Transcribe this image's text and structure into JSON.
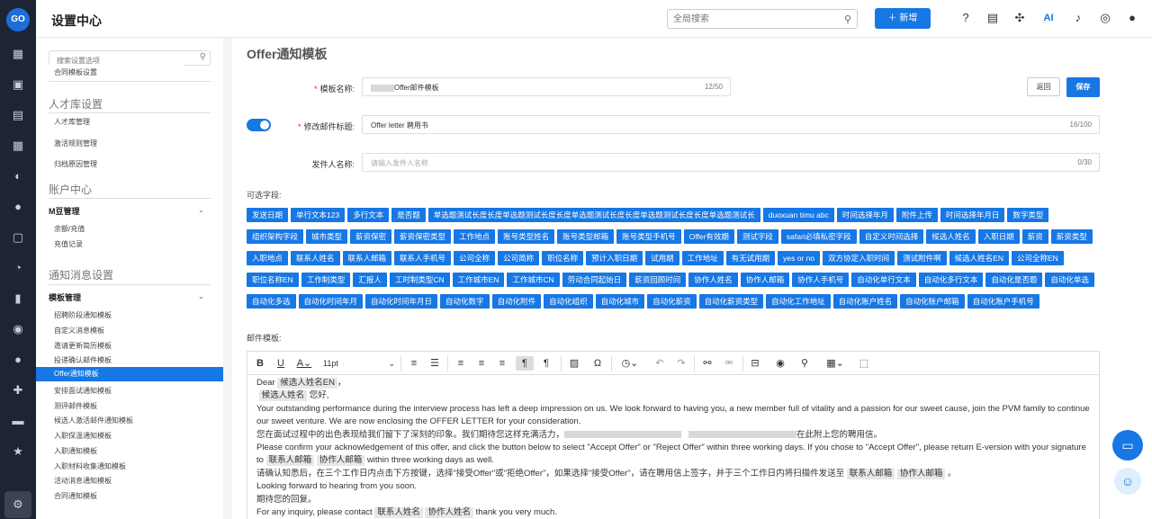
{
  "app": {
    "title": "设置中心",
    "logo_text": "GO"
  },
  "header": {
    "search_placeholder": "全局搜索",
    "new_button": "＋ 新增"
  },
  "sidebar": {
    "search_placeholder": "搜索设置选项",
    "top_item": "合同模板设置",
    "sec_talent": "人才库设置",
    "talent_items": [
      "人才库管理",
      "激活规则管理",
      "归档原因管理"
    ],
    "sec_account": "账户中心",
    "grp_m": "M豆管理",
    "m_items": [
      "余额/充值",
      "充值记录"
    ],
    "sec_notify": "通知消息设置",
    "grp_tpl": "模板管理",
    "tpl_items": [
      "招聘阶段通知模板",
      "自定义消息模板",
      "邀请更新简历模板",
      "投递确认邮件模板",
      "Offer通知模板",
      "安排面试通知模板",
      "测评邮件模板",
      "候选人激活邮件通知模板",
      "入职保温通知模板",
      "入职通知模板",
      "入职材料收集通知模板",
      "活动消息通知模板",
      "合同通知模板"
    ]
  },
  "form": {
    "page_title": "Offer通知模板",
    "name_label": "模板名称:",
    "name_value": "Offer邮件模板",
    "name_count": "12/50",
    "back_button": "返回",
    "save_button": "保存",
    "subject_label": "修改邮件标题:",
    "subject_value": "Offer letter 聘用书",
    "subject_count": "16/100",
    "sender_label": "发件人名称:",
    "sender_placeholder": "请输入发件人名称",
    "sender_count": "0/30",
    "fields_label": "可选字段:",
    "template_label": "邮件模板:"
  },
  "fields": [
    "发送日期",
    "单行文本123",
    "多行文本",
    "是否题",
    "单选题测试长度长度单选题测试长度长度单选题测试长度长度单选题测试长度长度单选题测试长",
    "duoxuan timu abc",
    "时间选择年月",
    "附件上传",
    "时间选择年月日",
    "数字类型",
    "组织架构字段",
    "城市类型",
    "薪资保密",
    "薪资保密类型",
    "工作地点",
    "账号类型姓名",
    "账号类型邮箱",
    "账号类型手机号",
    "Offer有效期",
    "测试字段",
    "safari必填私密字段",
    "自定义时间选择",
    "候选人姓名",
    "入职日期",
    "薪资",
    "薪资类型",
    "入职地点",
    "联系人姓名",
    "联系人邮箱",
    "联系人手机号",
    "公司全称",
    "公司简称",
    "职位名称",
    "预计入职日期",
    "试用期",
    "工作地址",
    "有无试用期",
    "yes or no",
    "双方协定入职时间",
    "测试附件啊",
    "候选人姓名EN",
    "公司全称EN",
    "职位名称EN",
    "工作制类型",
    "汇报人",
    "工时制类型CN",
    "工作城市EN",
    "工作城市CN",
    "劳动合同起始日",
    "薪资回顾时间",
    "协作人姓名",
    "协作人邮箱",
    "协作人手机号",
    "自动化单行文本",
    "自动化多行文本",
    "自动化是否题",
    "自动化单选",
    "自动化多选",
    "自动化时间年月",
    "自动化时间年月日",
    "自动化数字",
    "自动化附件",
    "自动化组织",
    "自动化城市",
    "自动化薪资",
    "自动化薪资类型",
    "自动化工作地址",
    "自动化账户姓名",
    "自动化账户邮箱",
    "自动化账户手机号"
  ],
  "editor": {
    "font_size": "11pt",
    "t_dear": "Dear",
    "tag_name_en": "候选人姓名EN",
    "t_comma": "，",
    "tag_name": "候选人姓名",
    "t_hello": "您好,",
    "p1": "Your outstanding performance during the interview process has left a deep impression on us. We look forward to having you, a new member full of vitality and a passion for our sweet cause, join the PVM family to continue our sweet venture. We are now enclosing the OFFER LETTER for your consideration.",
    "p2a": "您在面试过程中的出色表现给我们留下了深刻的印象。我们期待您这样充满活力，",
    "p2b": "在此附上您的聘用信。",
    "p3": "Please confirm your acknowledgement of this offer, and click the button below to select \"Accept Offer\" or \"Reject Offer\" within three working days. If you chose to \"Accept Offer\", please return E-version with your signature to",
    "tag_contact_email": "联系人邮箱",
    "tag_collab_email": "协作人邮箱",
    "p3b": "within three working days as well.",
    "p4": "请确认知悉后，在三个工作日内点击下方按键，选择\"接受Offer\"或\"拒绝Offer\"，如果选择\"接受Offer\"，请在聘用信上签字，并于三个工作日内将扫描件发送至",
    "t_period": "。",
    "p5": "Looking forward to hearing from you soon.",
    "p6": "期待您的回复。",
    "p7": "For any inquiry, please contact",
    "tag_contact_name": "联系人姓名",
    "tag_collab_name": "协作人姓名",
    "p7b": "thank you very much."
  }
}
